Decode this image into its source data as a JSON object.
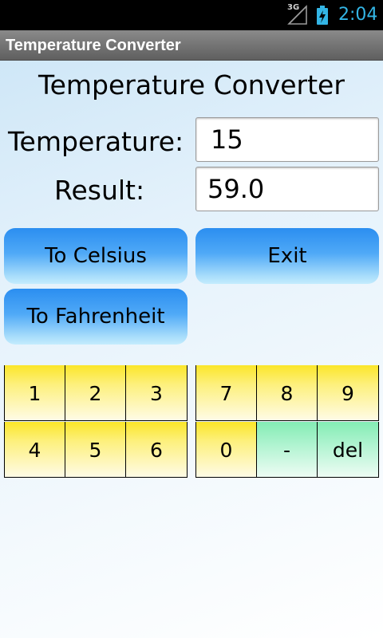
{
  "status_bar": {
    "network": "3G",
    "time": "2:04",
    "icons": [
      "signal-icon",
      "battery-charging-icon"
    ]
  },
  "title_bar": {
    "title": "Temperature Converter"
  },
  "main": {
    "heading": "Temperature Converter",
    "temperature_label": "Temperature:",
    "temperature_value": "15",
    "result_label": "Result:",
    "result_value": "59.0",
    "buttons": {
      "to_celsius": "To Celsius",
      "exit": "Exit",
      "to_fahrenheit": "To Fahrenheit"
    }
  },
  "keypad": {
    "left": [
      [
        "1",
        "2",
        "3"
      ],
      [
        "4",
        "5",
        "6"
      ]
    ],
    "right": [
      [
        "7",
        "8",
        "9"
      ],
      [
        "0",
        "-",
        "del"
      ]
    ]
  },
  "colors": {
    "status_accent": "#33b5e5",
    "button_blue": "#2b8ef0",
    "key_yellow": "#fbe629",
    "key_green": "#83ecb4"
  }
}
